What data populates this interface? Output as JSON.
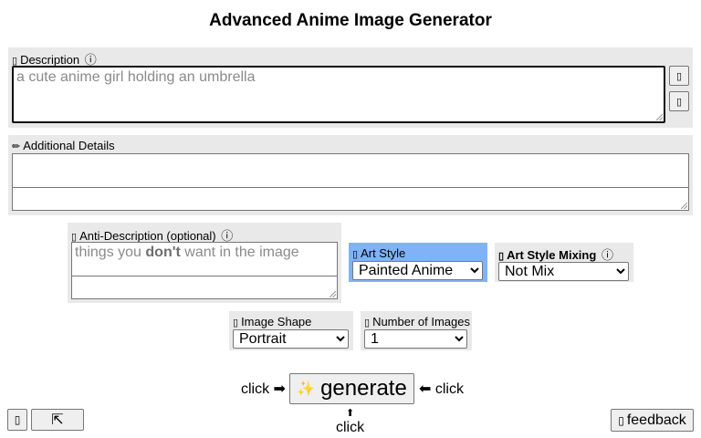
{
  "page": {
    "title": "Advanced Anime Image Generator"
  },
  "description": {
    "glyph": "▯",
    "label": "Description",
    "info_icon": "ⓘ",
    "placeholder": "a cute anime girl holding an umbrella",
    "side_button_1": "▯",
    "side_button_2": "▯"
  },
  "additional": {
    "glyph": "✏",
    "label": "Additional Details"
  },
  "anti": {
    "glyph": "▯",
    "label": "Anti-Description (optional)",
    "info_icon": "ⓘ",
    "placeholder_pre": "things you ",
    "placeholder_bold": "don't",
    "placeholder_post": " want in the image"
  },
  "art_style": {
    "glyph": "▯",
    "label": "Art Style",
    "selected": "Painted Anime",
    "accent": "#80b2f8"
  },
  "mixing": {
    "glyph": "▯",
    "label": "Art Style Mixing",
    "info_icon": "ⓘ",
    "selected": "Not Mix"
  },
  "shape": {
    "glyph": "▯",
    "label": "Image Shape",
    "selected": "Portrait"
  },
  "count": {
    "glyph": "▯",
    "label": "Number of Images",
    "selected": "1"
  },
  "generate": {
    "left_hint": "click ➡",
    "right_hint": "⬅ click",
    "below_arrow": "⬆",
    "below_hint": "click",
    "sparkle": "✨",
    "label": "generate"
  },
  "bottom": {
    "left_btn_1": "▯",
    "left_btn_2": "⇱",
    "feedback_glyph": "▯",
    "feedback_label": "feedback"
  }
}
